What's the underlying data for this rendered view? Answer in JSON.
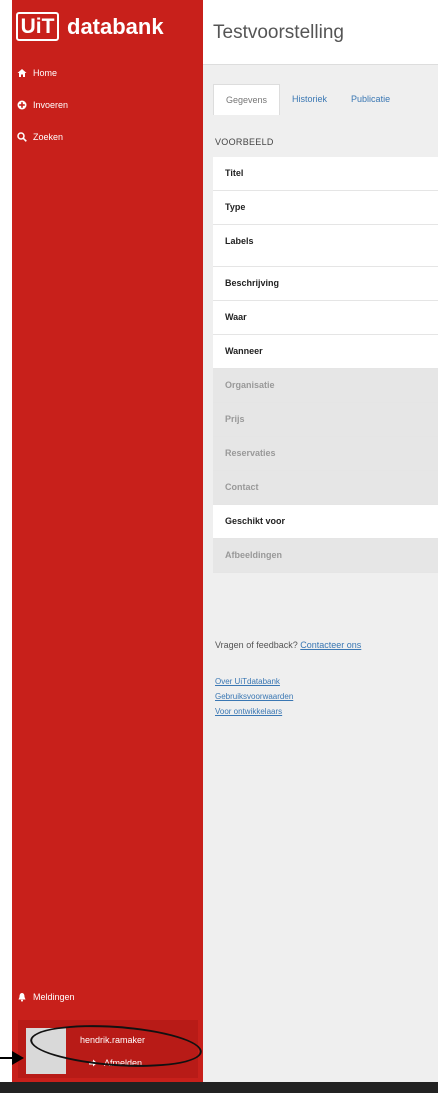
{
  "brand": {
    "logo_box": "UiT",
    "logo_text": "databank"
  },
  "header": {
    "title": "Testvoorstelling"
  },
  "sidebar": {
    "items": [
      {
        "label": "Home",
        "icon": "home-icon"
      },
      {
        "label": "Invoeren",
        "icon": "plus-circle-icon"
      },
      {
        "label": "Zoeken",
        "icon": "search-icon"
      }
    ],
    "notifications": "Meldingen",
    "user": {
      "name": "hendrik.ramaker",
      "logout": "Afmelden"
    }
  },
  "tabs": [
    {
      "label": "Gegevens",
      "active": true
    },
    {
      "label": "Historiek",
      "active": false
    },
    {
      "label": "Publicatie",
      "active": false
    }
  ],
  "section": "VOORBEELD",
  "fields": [
    {
      "label": "Titel",
      "filled": true
    },
    {
      "label": "Type",
      "filled": true
    },
    {
      "label": "Labels",
      "filled": true
    },
    {
      "label": "Beschrijving",
      "filled": true
    },
    {
      "label": "Waar",
      "filled": true
    },
    {
      "label": "Wanneer",
      "filled": true
    },
    {
      "label": "Organisatie",
      "filled": false
    },
    {
      "label": "Prijs",
      "filled": false
    },
    {
      "label": "Reservaties",
      "filled": false
    },
    {
      "label": "Contact",
      "filled": false
    },
    {
      "label": "Geschikt voor",
      "filled": true
    },
    {
      "label": "Afbeeldingen",
      "filled": false
    }
  ],
  "footer": {
    "question": "Vragen of feedback?",
    "contact": "Contacteer ons",
    "links": [
      "Over UiTdatabank",
      "Gebruiksvoorwaarden",
      "Voor ontwikkelaars"
    ]
  },
  "colors": {
    "brand_red": "#c8201b",
    "link_blue": "#3a77b3"
  }
}
